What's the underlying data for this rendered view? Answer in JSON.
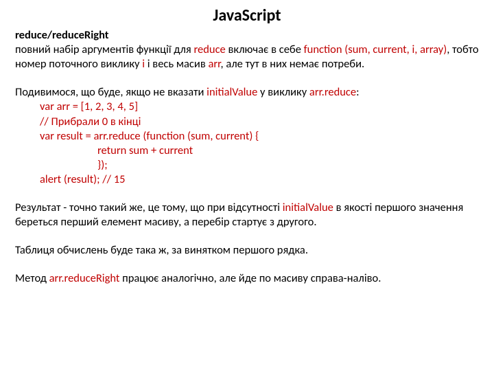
{
  "title": "JavaScript",
  "subheading": "reduce/reduceRight",
  "p1": {
    "t1": "повний набір аргументів функції для ",
    "k1": "reduce",
    "t2": " включає в себе ",
    "k2": "function (sum, current, i, array)",
    "t3": ", тобто номер поточного виклику ",
    "k3": "i",
    "t4": " і весь масив ",
    "k4": "arr",
    "t5": ", але тут в них немає потреби."
  },
  "p2": {
    "t1": "Подивимося, що буде, якщо не вказати ",
    "k1": "initialValue",
    "t2": " у виклику ",
    "k2": "arr.reduce",
    "t3": ":"
  },
  "code": {
    "l1": "var arr = [1, 2, 3, 4, 5]",
    "l2": "// Прибрали 0 в кінці",
    "l3": "var result = arr.reduce (function (sum, current) {",
    "l4": "return sum + current",
    "l5": "});",
    "l6": "alert (result); // 15"
  },
  "p3": {
    "t1": "Результат - точно такий же, це тому, що при відсутності ",
    "k1": "initialValue",
    "t2": " в якості першого значення береться перший елемент масиву, а перебір стартує з другого."
  },
  "p4": "Таблиця обчислень буде така ж, за винятком першого рядка.",
  "p5": {
    "t1": "Метод ",
    "k1": "arr.reduceRight",
    "t2": " працює аналогічно, але йде по масиву справа-наліво."
  }
}
